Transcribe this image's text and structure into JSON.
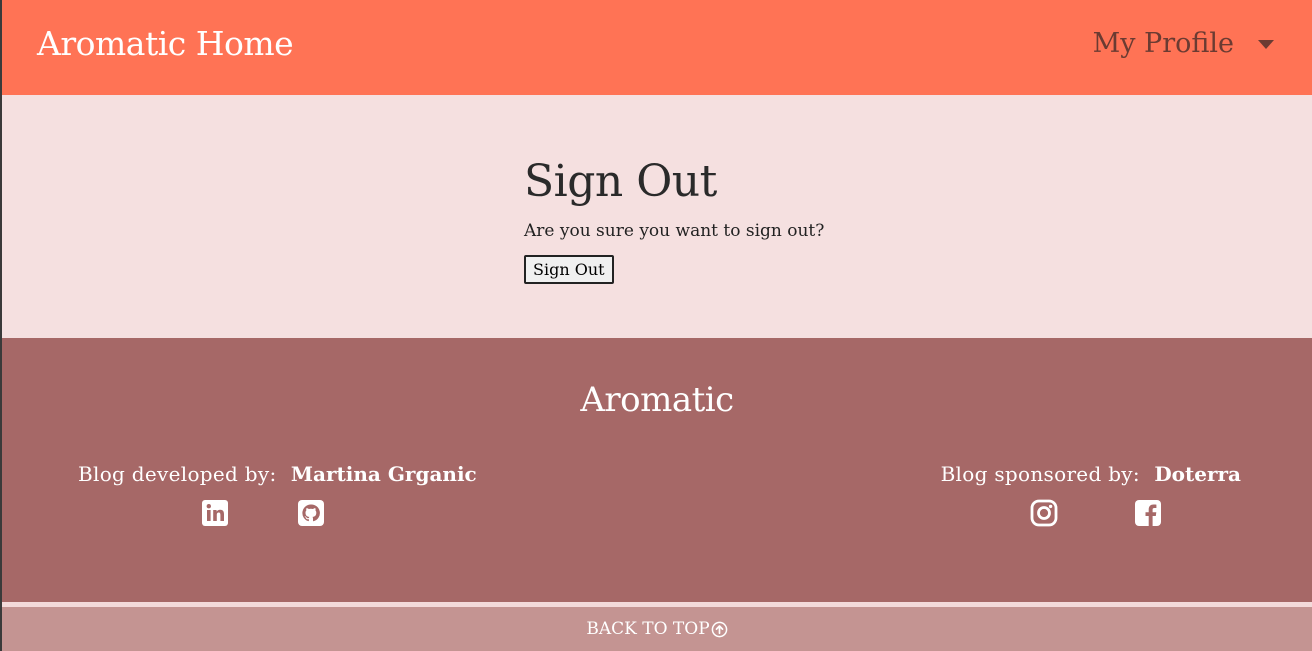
{
  "navbar": {
    "brand": "Aromatic Home",
    "profile_label": "My Profile"
  },
  "signout": {
    "title": "Sign Out",
    "message": "Are you sure you want to sign out?",
    "button_label": "Sign Out"
  },
  "footer": {
    "title": "Aromatic",
    "developed": {
      "label": "Blog developed by:",
      "name": "Martina Grganic"
    },
    "sponsored": {
      "label": "Blog sponsored by:",
      "name": "Doterra"
    },
    "icons": [
      "linkedin-icon",
      "github-icon",
      "instagram-icon",
      "facebook-icon"
    ]
  },
  "back_to_top": {
    "label": "BACK TO TOP"
  },
  "colors": {
    "navbar": "#ff7355",
    "main": "#f5e0e0",
    "footer": "#a66867",
    "back_to_top": "#c49492"
  }
}
